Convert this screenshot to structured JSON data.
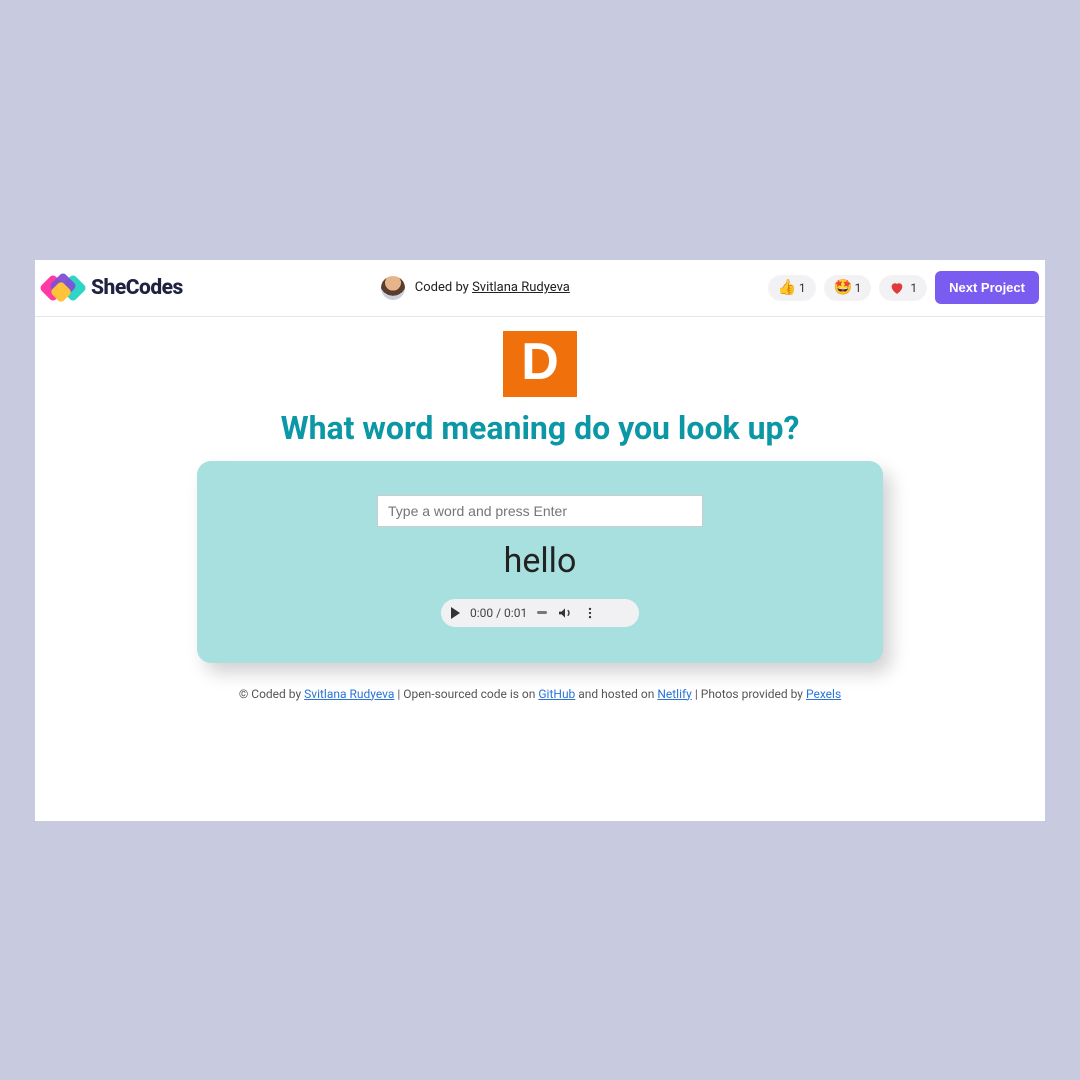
{
  "topbar": {
    "brand": "SheCodes",
    "coded_by_prefix": "Coded by ",
    "coded_by_name": "Svitlana Rudyeva",
    "reactions": {
      "thumbs": "1",
      "star_eyes": "1",
      "heart": "1"
    },
    "next_button": "Next Project"
  },
  "main": {
    "tile_letter": "D",
    "heading": "What word meaning do you look up?",
    "search_placeholder": "Type a word and press Enter",
    "current_word": "hello",
    "audio": {
      "time": "0:00 / 0:01"
    }
  },
  "footer": {
    "prefix": "© Coded by ",
    "author": "Svitlana Rudyeva",
    "mid1": "  | Open-sourced code is on ",
    "github": "GitHub",
    "mid2": "  and hosted on ",
    "netlify": "Netlify",
    "mid3": "  | Photos provided by ",
    "pexels": "Pexels"
  }
}
